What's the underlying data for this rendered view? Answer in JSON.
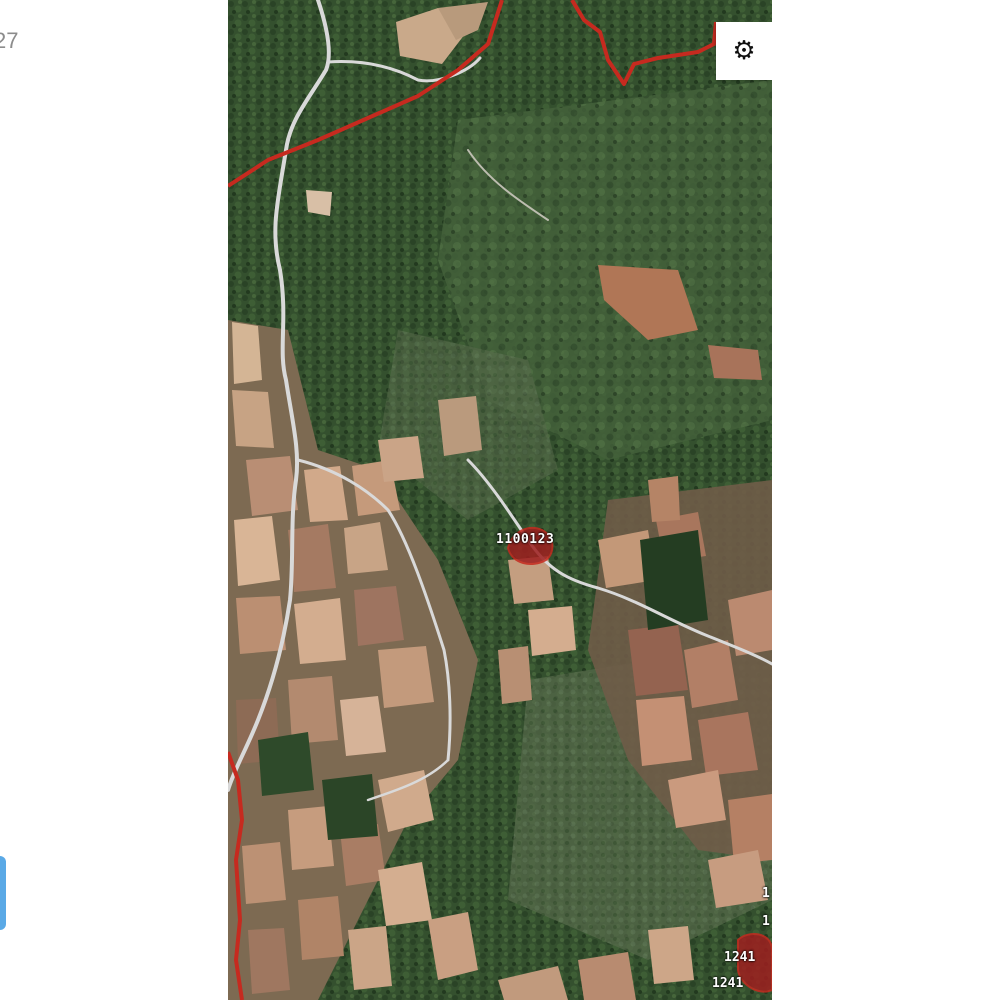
{
  "left_panel": {
    "clock_fragment": "27"
  },
  "map": {
    "view": "satellite",
    "boundary_color": "#c62a1f",
    "road_color": "#d9d9d9",
    "parcel_label": "1100123",
    "edge_labels": [
      "1",
      "1",
      "1241",
      "1241"
    ],
    "settings_icon": "gear-icon"
  }
}
